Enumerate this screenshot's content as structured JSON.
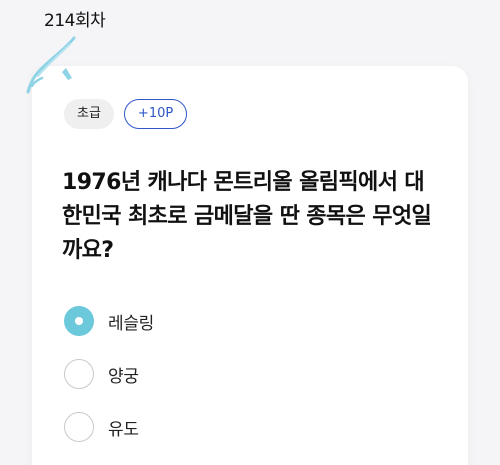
{
  "header": {
    "round_label": "214회차"
  },
  "quiz": {
    "level_badge": "초급",
    "points_badge": "+10P",
    "question": "1976년 캐나다 몬트리올 올림픽에서 대한민국 최초로 금메달을 딴 종목은 무엇일까요?",
    "options": [
      {
        "label": "레슬링",
        "selected": true
      },
      {
        "label": "양궁",
        "selected": false
      },
      {
        "label": "유도",
        "selected": false
      }
    ]
  },
  "colors": {
    "accent": "#6cc9dc",
    "points_badge": "#2f57c8",
    "brush_stroke": "#8fd3e6"
  },
  "icons": {
    "decoration": "brush-stroke-icon"
  }
}
